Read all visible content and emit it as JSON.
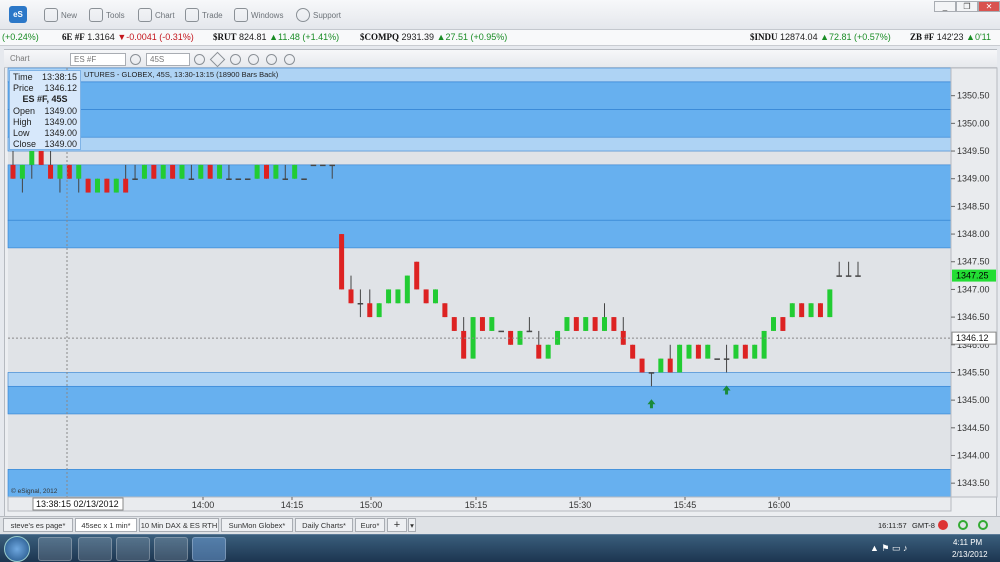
{
  "toolbar": {
    "new": "New",
    "tools": "Tools",
    "chart": "Chart",
    "trade": "Trade",
    "windows": "Windows",
    "support": "Support",
    "logo": "eS"
  },
  "window_controls": {
    "min": "_",
    "restore": "❐",
    "close": "✕"
  },
  "ticker": {
    "left_change": "(+0.24%)",
    "items": [
      {
        "sym": "6E #F",
        "last": "1.3164",
        "chg": "▼-0.0041 (-0.31%)",
        "dir": "dn"
      },
      {
        "sym": "$RUT",
        "last": "824.81",
        "chg": "▲11.48 (+1.41%)",
        "dir": "up"
      },
      {
        "sym": "$COMPQ",
        "last": "2931.39",
        "chg": "▲27.51 (+0.95%)",
        "dir": "up"
      },
      {
        "sym": "$INDU",
        "last": "12874.04",
        "chg": "▲72.81 (+0.57%)",
        "dir": "up"
      },
      {
        "sym": "ZB #F",
        "last": "142'23",
        "chg": "▲0'11",
        "dir": "up"
      }
    ]
  },
  "chart_header": {
    "title": "Chart",
    "symbol": "ES #F",
    "interval": "45S",
    "description": "UTURES - GLOBEX, 45S, 13:30-13:15 (18900 Bars Back)",
    "copyright": "© eSignal, 2012"
  },
  "info_panel": {
    "time_label": "Time",
    "time": "13:38:15",
    "price_label": "Price",
    "price": "1346.12",
    "symbol": "ES #F, 45S",
    "rows": [
      {
        "k": "Open",
        "v": "1349.00"
      },
      {
        "k": "High",
        "v": "1349.00"
      },
      {
        "k": "Low",
        "v": "1349.00"
      },
      {
        "k": "Close",
        "v": "1349.00"
      }
    ]
  },
  "crosshair_time": "13:38:15 02/13/2012",
  "crosshair_price": "1346.12",
  "last_price": "1347.25",
  "chart_data": {
    "type": "candlestick",
    "symbol": "ES #F",
    "interval": "45S",
    "ylim": [
      1343.25,
      1351.0
    ],
    "yticks": [
      "1343.50",
      "1344.00",
      "1344.50",
      "1345.00",
      "1345.50",
      "1346.00",
      "1346.50",
      "1347.00",
      "1347.50",
      "1348.00",
      "1348.50",
      "1349.00",
      "1349.50",
      "1350.00",
      "1350.50"
    ],
    "xticks": [
      "14:00",
      "14:15",
      "15:00",
      "15:15",
      "15:30",
      "15:45",
      "16:00"
    ],
    "price_zones": [
      [
        1348.25,
        1349.25
      ],
      [
        1349.5,
        1349.75
      ],
      [
        1349.75,
        1350.25
      ],
      [
        1350.25,
        1350.75
      ],
      [
        1350.75,
        1351.0
      ],
      [
        1345.25,
        1345.5
      ],
      [
        1344.75,
        1345.25
      ],
      [
        1343.25,
        1343.75
      ],
      [
        1347.75,
        1348.25
      ]
    ],
    "series": [
      {
        "name": "ES #F",
        "candles": [
          [
            1349.25,
            1349.5,
            1349.0,
            1349.0
          ],
          [
            1349.0,
            1349.25,
            1348.75,
            1349.25
          ],
          [
            1349.25,
            1349.5,
            1349.0,
            1349.5
          ],
          [
            1349.5,
            1349.5,
            1349.25,
            1349.25
          ],
          [
            1349.25,
            1349.5,
            1349.0,
            1349.0
          ],
          [
            1349.0,
            1349.25,
            1348.75,
            1349.25
          ],
          [
            1349.25,
            1349.25,
            1349.0,
            1349.0
          ],
          [
            1349.0,
            1349.25,
            1348.75,
            1349.25
          ],
          [
            1349.0,
            1349.0,
            1348.75,
            1348.75
          ],
          [
            1348.75,
            1349.0,
            1348.75,
            1349.0
          ],
          [
            1349.0,
            1349.0,
            1348.75,
            1348.75
          ],
          [
            1348.75,
            1349.0,
            1348.75,
            1349.0
          ],
          [
            1349.0,
            1349.25,
            1348.75,
            1348.75
          ],
          [
            1349.0,
            1349.25,
            1349.0,
            1349.0
          ],
          [
            1349.0,
            1349.25,
            1349.0,
            1349.25
          ],
          [
            1349.25,
            1349.25,
            1349.0,
            1349.0
          ],
          [
            1349.0,
            1349.25,
            1349.0,
            1349.25
          ],
          [
            1349.25,
            1349.25,
            1349.0,
            1349.0
          ],
          [
            1349.0,
            1349.25,
            1349.0,
            1349.25
          ],
          [
            1349.0,
            1349.25,
            1349.0,
            1349.0
          ],
          [
            1349.0,
            1349.25,
            1349.0,
            1349.25
          ],
          [
            1349.25,
            1349.25,
            1349.0,
            1349.0
          ],
          [
            1349.0,
            1349.25,
            1349.0,
            1349.25
          ],
          [
            1349.0,
            1349.25,
            1349.0,
            1349.0
          ],
          [
            1349.0,
            1349.0,
            1349.0,
            1349.0
          ],
          [
            1349.0,
            1349.0,
            1349.0,
            1349.0
          ],
          [
            1349.0,
            1349.25,
            1349.0,
            1349.25
          ],
          [
            1349.25,
            1349.25,
            1349.0,
            1349.0
          ],
          [
            1349.0,
            1349.25,
            1349.0,
            1349.25
          ],
          [
            1349.0,
            1349.25,
            1349.0,
            1349.0
          ],
          [
            1349.0,
            1349.25,
            1349.0,
            1349.25
          ],
          [
            1349.0,
            1349.0,
            1349.0,
            1349.0
          ],
          [
            1349.25,
            1349.25,
            1349.25,
            1349.25
          ],
          [
            1349.25,
            1349.25,
            1349.25,
            1349.25
          ],
          [
            1349.25,
            1349.25,
            1349.0,
            1349.25
          ],
          [
            1348.0,
            1348.0,
            1347.0,
            1347.0
          ],
          [
            1347.0,
            1347.25,
            1346.75,
            1346.75
          ],
          [
            1346.75,
            1347.0,
            1346.5,
            1346.75
          ],
          [
            1346.75,
            1347.0,
            1346.5,
            1346.5
          ],
          [
            1346.5,
            1346.75,
            1346.5,
            1346.75
          ],
          [
            1346.75,
            1347.0,
            1346.75,
            1347.0
          ],
          [
            1346.75,
            1347.0,
            1346.75,
            1347.0
          ],
          [
            1346.75,
            1347.25,
            1346.75,
            1347.25
          ],
          [
            1347.5,
            1347.5,
            1347.0,
            1347.0
          ],
          [
            1347.0,
            1347.0,
            1346.75,
            1346.75
          ],
          [
            1346.75,
            1347.0,
            1346.75,
            1347.0
          ],
          [
            1346.75,
            1346.75,
            1346.5,
            1346.5
          ],
          [
            1346.5,
            1346.5,
            1346.25,
            1346.25
          ],
          [
            1346.25,
            1346.5,
            1345.75,
            1345.75
          ],
          [
            1345.75,
            1346.5,
            1345.75,
            1346.5
          ],
          [
            1346.5,
            1346.5,
            1346.25,
            1346.25
          ],
          [
            1346.25,
            1346.5,
            1346.25,
            1346.5
          ],
          [
            1346.25,
            1346.25,
            1346.25,
            1346.25
          ],
          [
            1346.25,
            1346.25,
            1346.0,
            1346.0
          ],
          [
            1346.0,
            1346.25,
            1346.0,
            1346.25
          ],
          [
            1346.25,
            1346.5,
            1346.25,
            1346.25
          ],
          [
            1346.0,
            1346.25,
            1345.75,
            1345.75
          ],
          [
            1345.75,
            1346.0,
            1345.75,
            1346.0
          ],
          [
            1346.0,
            1346.25,
            1346.0,
            1346.25
          ],
          [
            1346.25,
            1346.5,
            1346.25,
            1346.5
          ],
          [
            1346.5,
            1346.5,
            1346.25,
            1346.25
          ],
          [
            1346.25,
            1346.5,
            1346.25,
            1346.5
          ],
          [
            1346.5,
            1346.5,
            1346.25,
            1346.25
          ],
          [
            1346.25,
            1346.75,
            1346.25,
            1346.5
          ],
          [
            1346.5,
            1346.5,
            1346.25,
            1346.25
          ],
          [
            1346.25,
            1346.5,
            1346.0,
            1346.0
          ],
          [
            1346.0,
            1346.0,
            1345.75,
            1345.75
          ],
          [
            1345.75,
            1345.75,
            1345.5,
            1345.5
          ],
          [
            1345.5,
            1345.5,
            1345.25,
            1345.5
          ],
          [
            1345.5,
            1345.75,
            1345.5,
            1345.75
          ],
          [
            1345.75,
            1346.0,
            1345.5,
            1345.5
          ],
          [
            1345.5,
            1346.0,
            1345.5,
            1346.0
          ],
          [
            1345.75,
            1346.0,
            1345.75,
            1346.0
          ],
          [
            1346.0,
            1346.0,
            1345.75,
            1345.75
          ],
          [
            1345.75,
            1346.0,
            1345.75,
            1346.0
          ],
          [
            1345.75,
            1345.75,
            1345.75,
            1345.75
          ],
          [
            1345.75,
            1346.0,
            1345.5,
            1345.75
          ],
          [
            1345.75,
            1346.0,
            1345.75,
            1346.0
          ],
          [
            1346.0,
            1346.0,
            1345.75,
            1345.75
          ],
          [
            1345.75,
            1346.0,
            1345.75,
            1346.0
          ],
          [
            1345.75,
            1346.25,
            1345.75,
            1346.25
          ],
          [
            1346.25,
            1346.5,
            1346.25,
            1346.5
          ],
          [
            1346.5,
            1346.5,
            1346.25,
            1346.25
          ],
          [
            1346.5,
            1346.75,
            1346.5,
            1346.75
          ],
          [
            1346.75,
            1346.75,
            1346.5,
            1346.5
          ],
          [
            1346.5,
            1346.75,
            1346.5,
            1346.75
          ],
          [
            1346.75,
            1346.75,
            1346.5,
            1346.5
          ],
          [
            1346.5,
            1347.0,
            1346.5,
            1347.0
          ],
          [
            1347.25,
            1347.5,
            1347.25,
            1347.25
          ],
          [
            1347.25,
            1347.5,
            1347.25,
            1347.25
          ],
          [
            1347.25,
            1347.5,
            1347.25,
            1347.25
          ]
        ]
      }
    ],
    "signals": [
      {
        "type": "buy-arrow",
        "bar": 68
      },
      {
        "type": "buy-arrow",
        "bar": 76
      }
    ]
  },
  "tabs": [
    "steve's es page*",
    "45sec x 1 min*",
    "10 Min DAX & ES RTH",
    "SunMon Globex*",
    "Daily Charts*",
    "Euro*"
  ],
  "status": {
    "clock": "16:11:57",
    "tz": "GMT-8"
  },
  "taskbar": {
    "time": "4:11 PM",
    "date": "2/13/2012"
  },
  "colors": {
    "up": "#22cc33",
    "down": "#dd2222",
    "zone": "#5aaaf0",
    "zone_light": "#a8d0f5",
    "bg": "#e0e3e7"
  }
}
